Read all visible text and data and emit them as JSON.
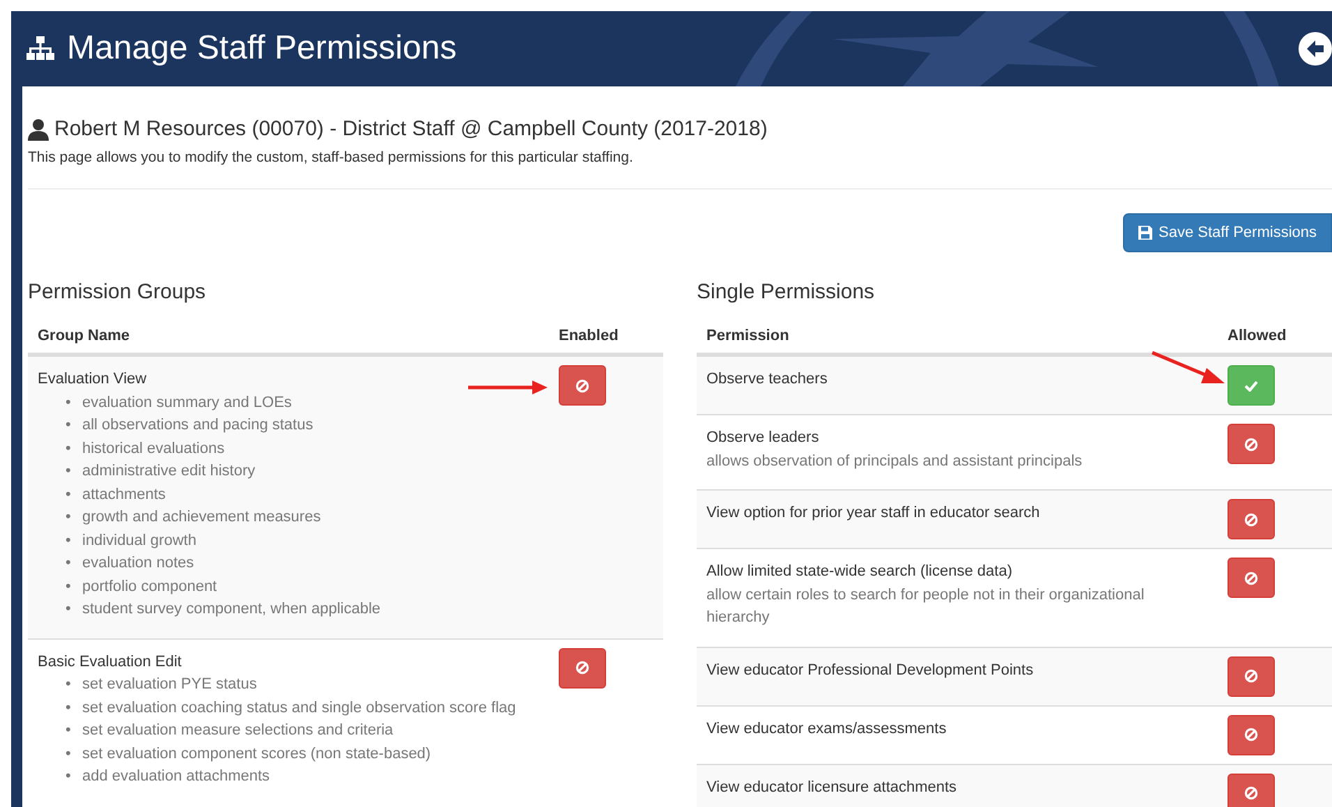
{
  "header": {
    "title": "Manage Staff Permissions"
  },
  "staff": {
    "name": "Robert M Resources (00070) - District Staff @ Campbell County (2017-2018)",
    "description": "This page allows you to modify the custom, staff-based permissions for this particular staffing."
  },
  "save_button": "Save Staff Permissions",
  "groups": {
    "title": "Permission Groups",
    "bullet": "•",
    "columns": [
      "Group Name",
      "Enabled"
    ],
    "rows": [
      {
        "name": "Evaluation View",
        "enabled": false,
        "marked": true,
        "items": [
          "evaluation summary and LOEs",
          "all observations and pacing status",
          "historical evaluations",
          "administrative edit history",
          "attachments",
          "growth and achievement measures",
          "individual growth",
          "evaluation notes",
          "portfolio component",
          "student survey component, when applicable"
        ]
      },
      {
        "name": "Basic Evaluation Edit",
        "enabled": false,
        "items": [
          "set evaluation PYE status",
          "set evaluation coaching status and single observation score flag",
          "set evaluation measure selections and criteria",
          "set evaluation component scores (non state-based)",
          "add evaluation attachments"
        ]
      }
    ]
  },
  "singles": {
    "title": "Single Permissions",
    "columns": [
      "Permission",
      "Allowed"
    ],
    "rows": [
      {
        "name": "Observe teachers",
        "allowed": true,
        "marked": true
      },
      {
        "name": "Observe leaders",
        "description": "allows observation of principals and assistant principals",
        "allowed": false
      },
      {
        "name": "View option for prior year staff in educator search",
        "allowed": false
      },
      {
        "name": "Allow limited state-wide search (license data)",
        "description": "allow certain roles to search for people not in their organizational hierarchy",
        "allowed": false
      },
      {
        "name": "View educator Professional Development Points",
        "allowed": false
      },
      {
        "name": "View educator exams/assessments",
        "allowed": false
      },
      {
        "name": "View educator licensure attachments",
        "allowed": false
      }
    ]
  }
}
